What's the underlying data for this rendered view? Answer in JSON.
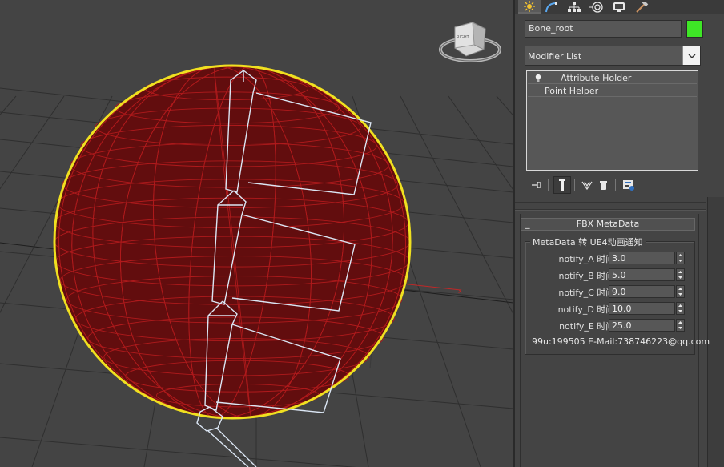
{
  "viewport": {
    "viewcube_label": "RIGHT",
    "colors": {
      "background": "#444444",
      "sphere_fill": "#6a0f10",
      "sphere_wire": "#b01a1c",
      "sphere_outline": "#f0e020",
      "bones": "#dbe6f4",
      "grid": "#2e2e2e"
    }
  },
  "command_panel": {
    "tabs": [
      {
        "icon": "create-icon"
      },
      {
        "icon": "modify-icon"
      },
      {
        "icon": "hierarchy-icon"
      },
      {
        "icon": "motion-icon"
      },
      {
        "icon": "display-icon"
      },
      {
        "icon": "utilities-icon"
      }
    ],
    "object_name": "Bone_root",
    "object_color": "#3ee626",
    "modifier_list_label": "Modifier List",
    "modifier_stack": [
      {
        "label": "Attribute Holder",
        "icon": "lightbulb-icon"
      },
      {
        "label": "Point Helper"
      }
    ],
    "stack_tools": [
      {
        "icon": "pin-stack-icon"
      },
      {
        "icon": "show-end-result-icon"
      },
      {
        "icon": "make-unique-icon"
      },
      {
        "icon": "remove-modifier-icon"
      },
      {
        "icon": "configure-modifier-sets-icon"
      }
    ]
  },
  "rollout": {
    "collapse_glyph": "_",
    "title": "FBX MetaData",
    "group_title": "MetaData 转 UE4动画通知",
    "params": [
      {
        "label": "notify_A 时间:",
        "value": "3.0"
      },
      {
        "label": "notify_B 时间:",
        "value": "5.0"
      },
      {
        "label": "notify_C 时间:",
        "value": "9.0"
      },
      {
        "label": "notify_D 时间:",
        "value": "10.0"
      },
      {
        "label": "notify_E 时间:",
        "value": "25.0"
      }
    ],
    "footer": "99u:199505 E-Mail:738746223@qq.com"
  }
}
